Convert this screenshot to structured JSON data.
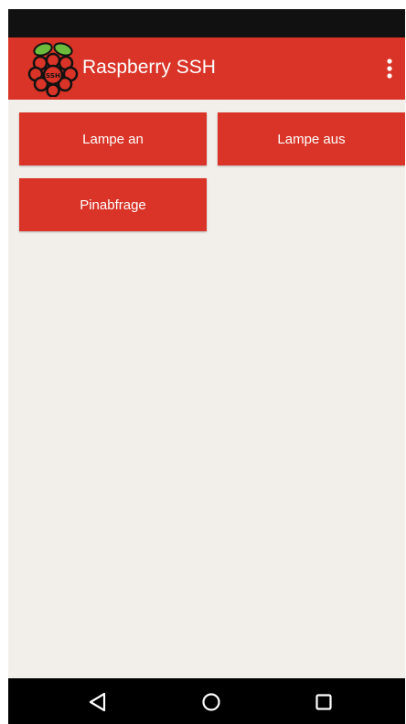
{
  "app_bar": {
    "title": "Raspberry SSH",
    "logo_icon": "raspberry-ssh-logo",
    "logo_text": "SSH",
    "menu_icon": "more-vert-icon",
    "color": "#d93427"
  },
  "buttons": [
    {
      "label": "Lampe an"
    },
    {
      "label": "Lampe aus"
    },
    {
      "label": "Pinabfrage"
    }
  ],
  "nav_bar": {
    "back_icon": "back-triangle-icon",
    "home_icon": "home-circle-icon",
    "recents_icon": "recents-square-icon"
  },
  "colors": {
    "accent": "#d93427",
    "background": "#f2efeb",
    "status_bar": "#111111",
    "nav_bar": "#000000"
  }
}
